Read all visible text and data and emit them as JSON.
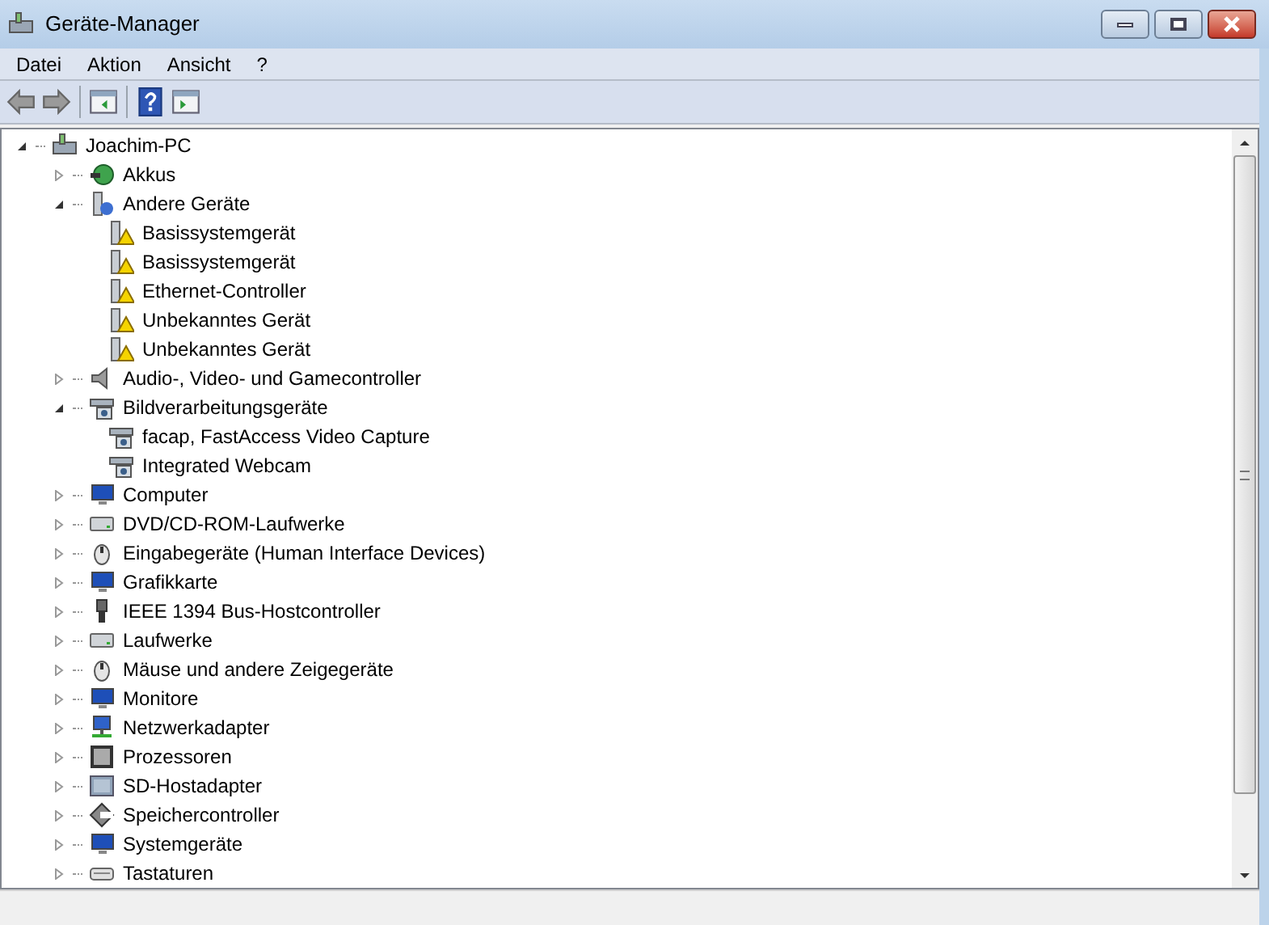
{
  "window": {
    "title": "Geräte-Manager"
  },
  "menu": [
    "Datei",
    "Aktion",
    "Ansicht",
    "?"
  ],
  "toolbar": [
    {
      "kind": "back",
      "disabled": true
    },
    {
      "kind": "forward",
      "disabled": true
    },
    {
      "kind": "sep"
    },
    {
      "kind": "panel"
    },
    {
      "kind": "sep"
    },
    {
      "kind": "help"
    },
    {
      "kind": "panel2"
    }
  ],
  "tree": {
    "label": "Joachim-PC",
    "kind": "computer",
    "expanded": true,
    "children": [
      {
        "label": "Akkus",
        "kind": "battery",
        "expanded": false
      },
      {
        "label": "Andere Geräte",
        "kind": "unknown",
        "expanded": true,
        "children": [
          {
            "label": "Basissystemgerät",
            "kind": "warning"
          },
          {
            "label": "Basissystemgerät",
            "kind": "warning"
          },
          {
            "label": "Ethernet-Controller",
            "kind": "warning"
          },
          {
            "label": "Unbekanntes Gerät",
            "kind": "warning"
          },
          {
            "label": "Unbekanntes Gerät",
            "kind": "warning"
          }
        ]
      },
      {
        "label": "Audio-, Video- und Gamecontroller",
        "kind": "speaker",
        "expanded": false
      },
      {
        "label": "Bildverarbeitungsgeräte",
        "kind": "camera",
        "expanded": true,
        "children": [
          {
            "label": "facap, FastAccess Video Capture",
            "kind": "camera"
          },
          {
            "label": "Integrated Webcam",
            "kind": "camera"
          }
        ]
      },
      {
        "label": "Computer",
        "kind": "monitor",
        "expanded": false
      },
      {
        "label": "DVD/CD-ROM-Laufwerke",
        "kind": "drive",
        "expanded": false
      },
      {
        "label": "Eingabegeräte (Human Interface Devices)",
        "kind": "mouse",
        "expanded": false
      },
      {
        "label": "Grafikkarte",
        "kind": "monitor",
        "expanded": false
      },
      {
        "label": "IEEE 1394 Bus-Hostcontroller",
        "kind": "plug",
        "expanded": false
      },
      {
        "label": "Laufwerke",
        "kind": "drive",
        "expanded": false
      },
      {
        "label": "Mäuse und andere Zeigegeräte",
        "kind": "mouse",
        "expanded": false
      },
      {
        "label": "Monitore",
        "kind": "monitor",
        "expanded": false
      },
      {
        "label": "Netzwerkadapter",
        "kind": "network",
        "expanded": false
      },
      {
        "label": "Prozessoren",
        "kind": "chip",
        "expanded": false
      },
      {
        "label": "SD-Hostadapter",
        "kind": "card",
        "expanded": false
      },
      {
        "label": "Speichercontroller",
        "kind": "diamond",
        "expanded": false
      },
      {
        "label": "Systemgeräte",
        "kind": "monitor",
        "expanded": false
      },
      {
        "label": "Tastaturen",
        "kind": "keyboard",
        "expanded": false
      }
    ]
  }
}
